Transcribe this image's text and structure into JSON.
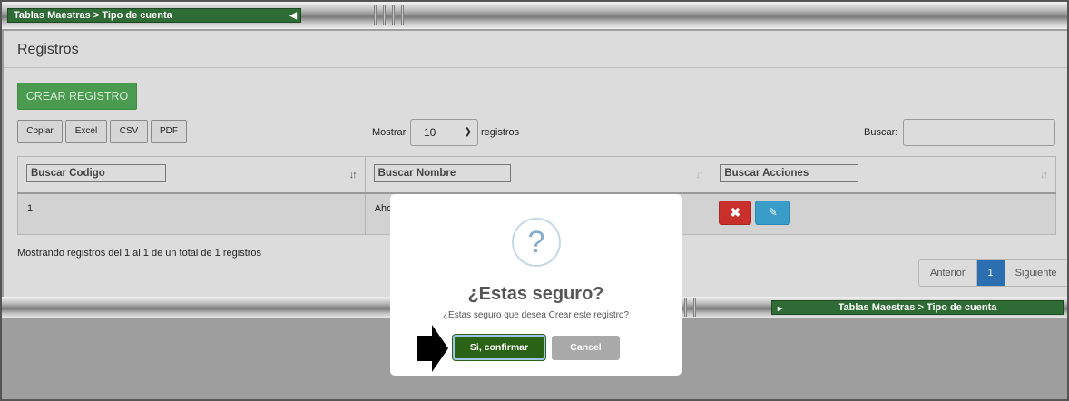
{
  "header": {
    "breadcrumb": "Tablas Maestras > Tipo de cuenta"
  },
  "panel": {
    "title": "Registros"
  },
  "toolbar": {
    "create_label": "CREAR REGISTRO",
    "export_buttons": [
      "Copiar",
      "Excel",
      "CSV",
      "PDF"
    ],
    "show_label": "Mostrar",
    "show_value": "10",
    "show_suffix": "registros",
    "search_label": "Buscar:",
    "search_value": ""
  },
  "table": {
    "columns": [
      {
        "placeholder": "Buscar Codigo"
      },
      {
        "placeholder": "Buscar Nombre"
      },
      {
        "placeholder": "Buscar Acciones"
      }
    ],
    "rows": [
      {
        "codigo": "1",
        "nombre": "Aho"
      }
    ]
  },
  "footer": {
    "info": "Mostrando registros del 1 al 1 de un total de 1 registros",
    "prev_label": "Anterior",
    "current_page": "1",
    "next_label": "Siguiente"
  },
  "bottom_bar": {
    "breadcrumb": "Tablas Maestras > Tipo de cuenta"
  },
  "modal": {
    "icon": "question-icon",
    "icon_glyph": "?",
    "title": "¿Estas seguro?",
    "text": "¿Estas seguro que desea Crear este registro?",
    "confirm_label": "Si, confirmar",
    "cancel_label": "Cancel"
  },
  "colors": {
    "brand_green": "#2f6b34",
    "create_button": "#4a9a4f",
    "confirm_button": "#2a6315",
    "delete_button": "#c9302c",
    "edit_button": "#3a9cc8",
    "pager_active": "#2b6fb0"
  }
}
